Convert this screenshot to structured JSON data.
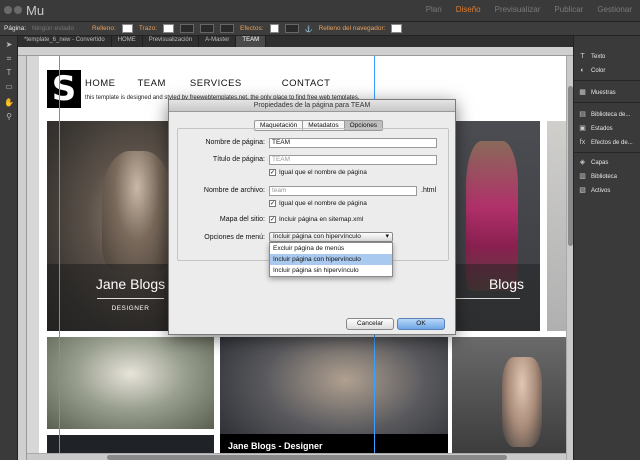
{
  "app": {
    "logo": "Mu",
    "modes": [
      "Plan",
      "Diseño",
      "Previsualizar",
      "Publicar",
      "Gestionar"
    ],
    "active_mode": "Diseño"
  },
  "control_bar": {
    "page_label": "Página:",
    "page_state": "Ningún estado",
    "fill_label": "Relleno:",
    "stroke_label": "Trazo:",
    "effects_label": "Efectos:",
    "browser_fill_label": "Relleno del navegador:"
  },
  "tabs": [
    "*template_6_new - Convertido",
    "HOME",
    "Previsualización",
    "A-Master",
    "TEAM"
  ],
  "site": {
    "logo_letter": "S",
    "nav": [
      "HOME",
      "TEAM",
      "SERVICES",
      "CONTACT"
    ],
    "credit": "this template is designed and styled by freewebtemplates.net, the only place to find free web templates.",
    "card1_title": "Jane Blogs",
    "card1_sub": "DESIGNER",
    "card2_title": "Blogs",
    "card3_caption": "Jane Blogs - Designer"
  },
  "right_panel": [
    {
      "icon": "text-icon",
      "glyph": "T",
      "label": "Texto"
    },
    {
      "icon": "color-icon",
      "glyph": "◐",
      "label": "Color"
    },
    {
      "icon": "swatches-icon",
      "glyph": "▦",
      "label": "Muestras"
    },
    {
      "icon": "library-icon",
      "glyph": "▤",
      "label": "Biblioteca de..."
    },
    {
      "icon": "states-icon",
      "glyph": "▣",
      "label": "Estados"
    },
    {
      "icon": "effects-icon",
      "glyph": "fx",
      "label": "Efectos de de..."
    },
    {
      "icon": "layers-icon",
      "glyph": "◈",
      "label": "Capas"
    },
    {
      "icon": "library2-icon",
      "glyph": "▥",
      "label": "Biblioteca"
    },
    {
      "icon": "assets-icon",
      "glyph": "▧",
      "label": "Activos"
    }
  ],
  "dialog": {
    "title": "Propiedades de la página para TEAM",
    "tabs": [
      "Maquetación",
      "Metadatos",
      "Opciones"
    ],
    "active_tab": "Opciones",
    "page_name_label": "Nombre de página:",
    "page_name_value": "TEAM",
    "page_title_label": "Título de página:",
    "page_title_value": "TEAM",
    "same_name_label": "Igual que el nombre de página",
    "file_name_label": "Nombre de archivo:",
    "file_name_value": "team",
    "file_ext": ".html",
    "same_name_label2": "Igual que el nombre de página",
    "sitemap_label": "Mapa del sitio:",
    "sitemap_check_label": "Incluir página en sitemap.xml",
    "menu_options_label": "Opciones de menú:",
    "menu_selected": "Incluir página con hipervínculo",
    "menu_options": [
      "Excluir página de menús",
      "Incluir página con hipervínculo",
      "Incluir página sin hipervínculo"
    ],
    "cancel_label": "Cancelar",
    "ok_label": "OK"
  }
}
